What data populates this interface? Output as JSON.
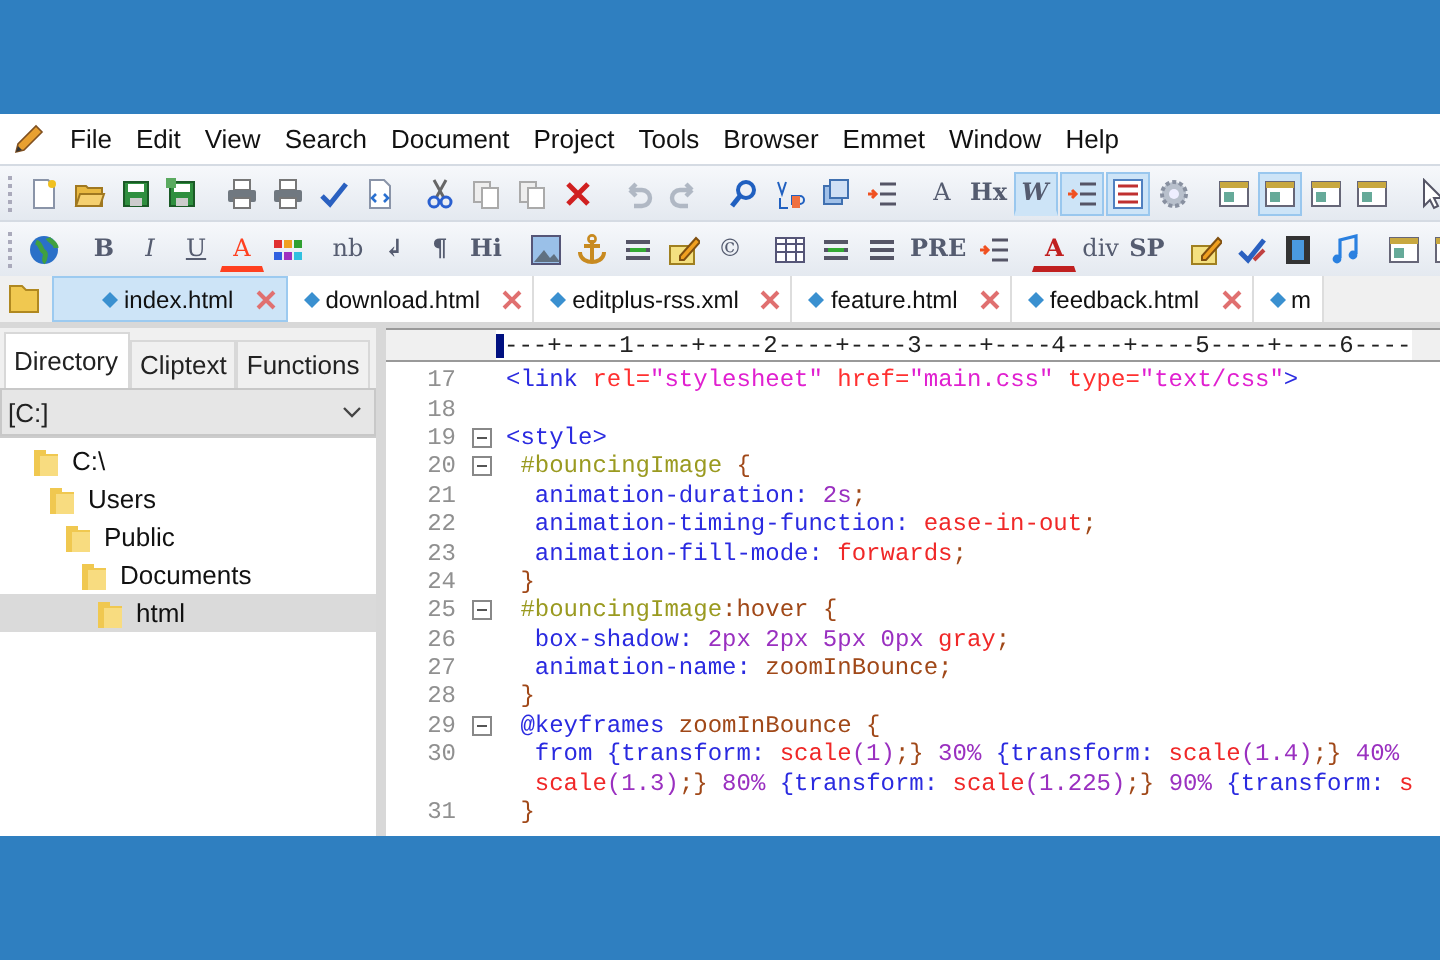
{
  "menu": [
    "File",
    "Edit",
    "View",
    "Search",
    "Document",
    "Project",
    "Tools",
    "Browser",
    "Emmet",
    "Window",
    "Help"
  ],
  "toolbar_1": [
    {
      "kind": "icon",
      "pressed": false
    },
    {
      "kind": "icon",
      "pressed": false
    },
    {
      "kind": "icon",
      "pressed": false
    },
    {
      "kind": "icon",
      "pressed": false
    },
    {
      "kind": "sep"
    },
    {
      "kind": "icon",
      "pressed": false
    },
    {
      "kind": "icon",
      "pressed": false
    },
    {
      "kind": "icon",
      "pressed": false
    },
    {
      "kind": "icon",
      "pressed": false
    },
    {
      "kind": "sep"
    },
    {
      "kind": "icon",
      "pressed": false
    },
    {
      "kind": "icon",
      "pressed": false
    },
    {
      "kind": "icon",
      "pressed": false
    },
    {
      "kind": "icon",
      "pressed": false
    },
    {
      "kind": "sep"
    },
    {
      "kind": "icon",
      "pressed": false
    },
    {
      "kind": "icon",
      "pressed": false
    },
    {
      "kind": "sep"
    },
    {
      "kind": "icon",
      "pressed": false
    },
    {
      "kind": "icon",
      "pressed": false
    },
    {
      "kind": "icon",
      "pressed": false
    },
    {
      "kind": "icon",
      "pressed": false
    },
    {
      "kind": "sep"
    },
    {
      "kind": "glyph",
      "text": "A",
      "bold": false,
      "italic": false,
      "underline": false,
      "pressed": false
    },
    {
      "kind": "glyph",
      "text": "Hx",
      "bold": true,
      "italic": false,
      "underline": false,
      "pressed": false
    },
    {
      "kind": "glyph",
      "text": "W",
      "bold": true,
      "italic": true,
      "underline": false,
      "pressed": true
    },
    {
      "kind": "icon",
      "pressed": true
    },
    {
      "kind": "icon",
      "pressed": true
    },
    {
      "kind": "icon",
      "pressed": false
    },
    {
      "kind": "sep"
    },
    {
      "kind": "icon",
      "pressed": false
    },
    {
      "kind": "icon",
      "pressed": true
    },
    {
      "kind": "icon",
      "pressed": false
    },
    {
      "kind": "icon",
      "pressed": false
    },
    {
      "kind": "sep"
    },
    {
      "kind": "icon",
      "pressed": false
    }
  ],
  "toolbar_2": [
    {
      "kind": "icon",
      "pressed": false
    },
    {
      "kind": "sep"
    },
    {
      "kind": "glyph",
      "text": "B",
      "bold": true,
      "italic": false,
      "underline": false,
      "pressed": false
    },
    {
      "kind": "glyph",
      "text": "I",
      "bold": false,
      "italic": true,
      "underline": false,
      "pressed": false
    },
    {
      "kind": "glyph",
      "text": "U",
      "bold": false,
      "italic": false,
      "underline": true,
      "pressed": false
    },
    {
      "kind": "glyph",
      "text": "A",
      "bold": false,
      "italic": false,
      "underline": false,
      "pressed": false,
      "color": "#ff4020"
    },
    {
      "kind": "icon",
      "pressed": false
    },
    {
      "kind": "sep"
    },
    {
      "kind": "glyph",
      "text": "nb",
      "bold": false,
      "italic": false,
      "underline": false,
      "pressed": false
    },
    {
      "kind": "glyph",
      "text": "↲",
      "bold": true,
      "italic": false,
      "underline": false,
      "pressed": false
    },
    {
      "kind": "glyph",
      "text": "¶",
      "bold": true,
      "italic": false,
      "underline": false,
      "pressed": false
    },
    {
      "kind": "glyph",
      "text": "Hi",
      "bold": true,
      "italic": false,
      "underline": false,
      "pressed": false
    },
    {
      "kind": "sep"
    },
    {
      "kind": "icon",
      "pressed": false
    },
    {
      "kind": "icon",
      "pressed": false
    },
    {
      "kind": "icon",
      "pressed": false
    },
    {
      "kind": "icon",
      "pressed": false
    },
    {
      "kind": "glyph",
      "text": "©",
      "bold": false,
      "underline": false,
      "pressed": false
    },
    {
      "kind": "sep"
    },
    {
      "kind": "icon",
      "pressed": false
    },
    {
      "kind": "icon",
      "pressed": false
    },
    {
      "kind": "icon",
      "pressed": false
    },
    {
      "kind": "glyph",
      "text": "PRE",
      "bold": true,
      "italic": false,
      "underline": false,
      "pressed": false
    },
    {
      "kind": "icon",
      "pressed": false
    },
    {
      "kind": "sep"
    },
    {
      "kind": "glyph",
      "text": "A",
      "bold": true,
      "italic": false,
      "underline": false,
      "pressed": false,
      "color": "#c02020"
    },
    {
      "kind": "glyph",
      "text": "div",
      "bold": false,
      "italic": false,
      "underline": false,
      "pressed": false
    },
    {
      "kind": "glyph",
      "text": "SP",
      "bold": true,
      "italic": false,
      "underline": false,
      "pressed": false
    },
    {
      "kind": "sep"
    },
    {
      "kind": "icon",
      "pressed": false
    },
    {
      "kind": "icon",
      "pressed": false
    },
    {
      "kind": "icon",
      "pressed": false
    },
    {
      "kind": "icon",
      "pressed": false
    },
    {
      "kind": "sep"
    },
    {
      "kind": "icon",
      "pressed": false
    },
    {
      "kind": "icon",
      "pressed": false
    }
  ],
  "file_tabs": [
    {
      "label": "index.html",
      "selected": true
    },
    {
      "label": "download.html",
      "selected": false
    },
    {
      "label": "editplus-rss.xml",
      "selected": false
    },
    {
      "label": "feature.html",
      "selected": false
    },
    {
      "label": "feedback.html",
      "selected": false
    },
    {
      "label": "m",
      "selected": false
    }
  ],
  "sidebar": {
    "tabs": [
      {
        "label": "Directory",
        "selected": true
      },
      {
        "label": "Cliptext",
        "selected": false
      },
      {
        "label": "Functions",
        "selected": false
      }
    ],
    "drive": "[C:]",
    "tree": [
      {
        "label": "C:\\",
        "selected": false,
        "children": [
          {
            "label": "Users",
            "selected": false,
            "children": [
              {
                "label": "Public",
                "selected": false,
                "children": [
                  {
                    "label": "Documents",
                    "selected": false,
                    "children": [
                      {
                        "label": "html",
                        "selected": true
                      }
                    ]
                  }
                ]
              }
            ]
          }
        ]
      }
    ]
  },
  "editor": {
    "ruler": "---+----1----+----2----+----3----+----4----+----5----+----6----",
    "lines": [
      {
        "number": "17",
        "fold": false,
        "tokens": [
          {
            "kind": "tag",
            "t": "<link"
          },
          {
            "kind": "attr",
            "t": " rel="
          },
          {
            "kind": "str",
            "t": "\"stylesheet\""
          },
          {
            "kind": "attr",
            "t": " href="
          },
          {
            "kind": "str",
            "t": "\"main.css\""
          },
          {
            "kind": "attr",
            "t": " type="
          },
          {
            "kind": "str",
            "t": "\"text/css\""
          },
          {
            "kind": "tag",
            "t": ">"
          }
        ]
      },
      {
        "number": "18",
        "fold": false
      },
      {
        "number": "19",
        "fold": true,
        "tokens": [
          {
            "kind": "tag",
            "t": "<style>"
          }
        ]
      },
      {
        "number": "20",
        "fold": true,
        "tokens": [
          {
            "kind": "sel",
            "t": " #bouncingImage"
          },
          {
            "kind": "punct",
            "t": " {"
          }
        ]
      },
      {
        "number": "21",
        "fold": false,
        "tokens": [
          {
            "kind": "prop",
            "t": "  animation-duration:"
          },
          {
            "kind": "num",
            "t": " 2s"
          },
          {
            "kind": "punct",
            "t": ";"
          }
        ]
      },
      {
        "number": "22",
        "fold": false,
        "tokens": [
          {
            "kind": "prop",
            "t": "  animation-timing-function:"
          },
          {
            "kind": "val",
            "t": " ease-in-out"
          },
          {
            "kind": "punct",
            "t": ";"
          }
        ]
      },
      {
        "number": "23",
        "fold": false,
        "tokens": [
          {
            "kind": "prop",
            "t": "  animation-fill-mode:"
          },
          {
            "kind": "val",
            "t": " forwards"
          },
          {
            "kind": "punct",
            "t": ";"
          }
        ]
      },
      {
        "number": "24",
        "fold": false,
        "tokens": [
          {
            "kind": "punct",
            "t": " }"
          }
        ]
      },
      {
        "number": "25",
        "fold": true,
        "tokens": [
          {
            "kind": "sel",
            "t": " #bouncingImage"
          },
          {
            "kind": "punct",
            "t": ":hover {"
          }
        ]
      },
      {
        "number": "26",
        "fold": false,
        "tokens": [
          {
            "kind": "prop",
            "t": "  box-shadow:"
          },
          {
            "kind": "num",
            "t": " 2px 2px 5px 0px"
          },
          {
            "kind": "val",
            "t": " gray"
          },
          {
            "kind": "punct",
            "t": ";"
          }
        ]
      },
      {
        "number": "27",
        "fold": false,
        "tokens": [
          {
            "kind": "prop",
            "t": "  animation-name:"
          },
          {
            "kind": "punct",
            "t": " zoomInBounce;"
          }
        ]
      },
      {
        "number": "28",
        "fold": false,
        "tokens": [
          {
            "kind": "punct",
            "t": " }"
          }
        ]
      },
      {
        "number": "29",
        "fold": true,
        "tokens": [
          {
            "kind": "prop",
            "t": " @keyframes"
          },
          {
            "kind": "punct",
            "t": " zoomInBounce {"
          }
        ]
      },
      {
        "number": "30",
        "fold": false,
        "tokens": [
          {
            "kind": "prop",
            "t": "  from {transform:"
          },
          {
            "kind": "val",
            "t": " scale"
          },
          {
            "kind": "num",
            "t": "(1)"
          },
          {
            "kind": "punct",
            "t": ";}"
          },
          {
            "kind": "num",
            "t": " 30%"
          },
          {
            "kind": "prop",
            "t": " {transform:"
          },
          {
            "kind": "val",
            "t": " scale"
          },
          {
            "kind": "num",
            "t": "(1.4)"
          },
          {
            "kind": "punct",
            "t": ";}"
          },
          {
            "kind": "num",
            "t": " 40%"
          }
        ]
      },
      {
        "fold": false,
        "tokens": [
          {
            "kind": "val",
            "t": "  scale"
          },
          {
            "kind": "num",
            "t": "(1.3)"
          },
          {
            "kind": "punct",
            "t": ";}"
          },
          {
            "kind": "num",
            "t": " 80%"
          },
          {
            "kind": "prop",
            "t": " {transform:"
          },
          {
            "kind": "val",
            "t": " scale"
          },
          {
            "kind": "num",
            "t": "(1.225)"
          },
          {
            "kind": "punct",
            "t": ";}"
          },
          {
            "kind": "num",
            "t": " 90%"
          },
          {
            "kind": "prop",
            "t": " {transform:"
          },
          {
            "kind": "val",
            "t": " s"
          }
        ]
      },
      {
        "number": "31",
        "fold": false,
        "tokens": [
          {
            "kind": "punct",
            "t": " }"
          }
        ]
      }
    ]
  }
}
